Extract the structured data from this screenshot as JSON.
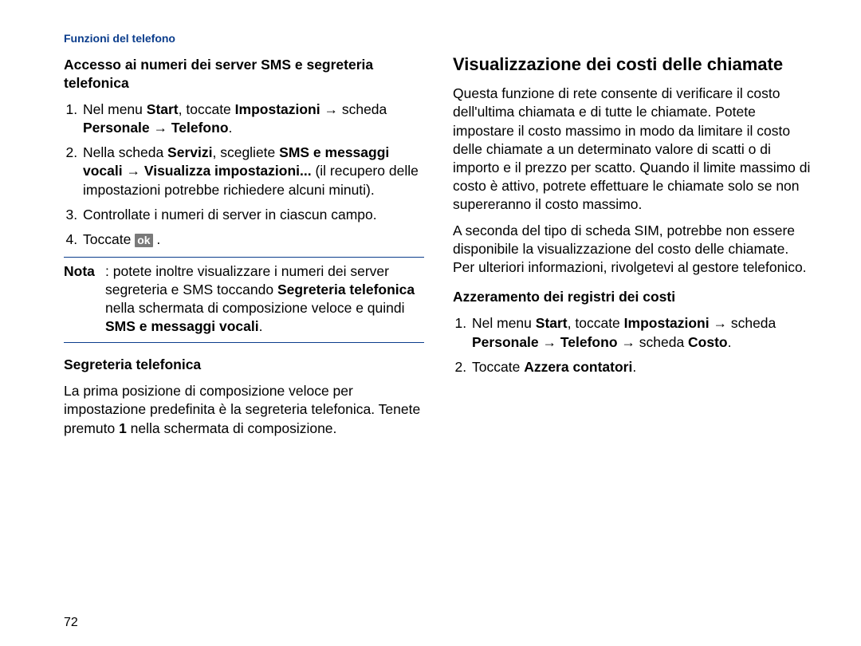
{
  "header": "Funzioni del telefono",
  "page_number": "72",
  "ok_button": "ok",
  "left": {
    "h1": "Accesso ai numeri dei server SMS e segreteria telefonica",
    "step1": {
      "a": "Nel menu ",
      "b": "Start",
      "c": ", toccate ",
      "d": "Impostazioni",
      "e": " → scheda ",
      "f": "Personale",
      "g": " → ",
      "h": "Telefono",
      "i": "."
    },
    "step2": {
      "a": "Nella scheda ",
      "b": "Servizi",
      "c": ", scegliete ",
      "d": "SMS e messaggi vocali",
      "e": " → ",
      "f": "Visualizza impostazioni...",
      "g": " (il recupero delle impostazioni potrebbe richiedere alcuni minuti)."
    },
    "step3": "Controllate i numeri di server in ciascun campo.",
    "step4_a": "Toccate ",
    "step4_c": ".",
    "nota_label": "Nota",
    "nota_a": ": potete inoltre visualizzare i numeri dei server segreteria e SMS toccando ",
    "nota_b": "Segreteria telefonica",
    "nota_c": " nella schermata di composizione veloce e quindi ",
    "nota_d": "SMS e messaggi vocali",
    "nota_e": ".",
    "h2": "Segreteria telefonica",
    "p2_a": "La prima posizione di composizione veloce per impostazione predefinita è la segreteria telefonica. Tenete premuto ",
    "p2_b": "1",
    "p2_c": " nella schermata di composizione."
  },
  "right": {
    "h1": "Visualizzazione dei costi delle chiamate",
    "p1": "Questa funzione di rete consente di verificare il costo dell'ultima chiamata e di tutte le chiamate. Potete impostare il costo massimo in modo da limitare il costo delle chiamate a un determinato valore di scatti o di importo e il prezzo per scatto. Quando il limite massimo di costo è attivo, potrete effettuare le chiamate solo se non supereranno il costo massimo.",
    "p2": "A seconda del tipo di scheda SIM, potrebbe non essere disponibile la visualizzazione del costo delle chiamate. Per ulteriori informazioni, rivolgetevi al gestore telefonico.",
    "h2": "Azzeramento dei registri dei costi",
    "step1": {
      "a": "Nel menu ",
      "b": "Start",
      "c": ", toccate ",
      "d": "Impostazioni",
      "e": " → scheda ",
      "f": "Personale",
      "g": " → ",
      "h": "Telefono",
      "i": " → scheda ",
      "j": "Costo",
      "k": "."
    },
    "step2": {
      "a": "Toccate ",
      "b": "Azzera contatori",
      "c": "."
    }
  }
}
